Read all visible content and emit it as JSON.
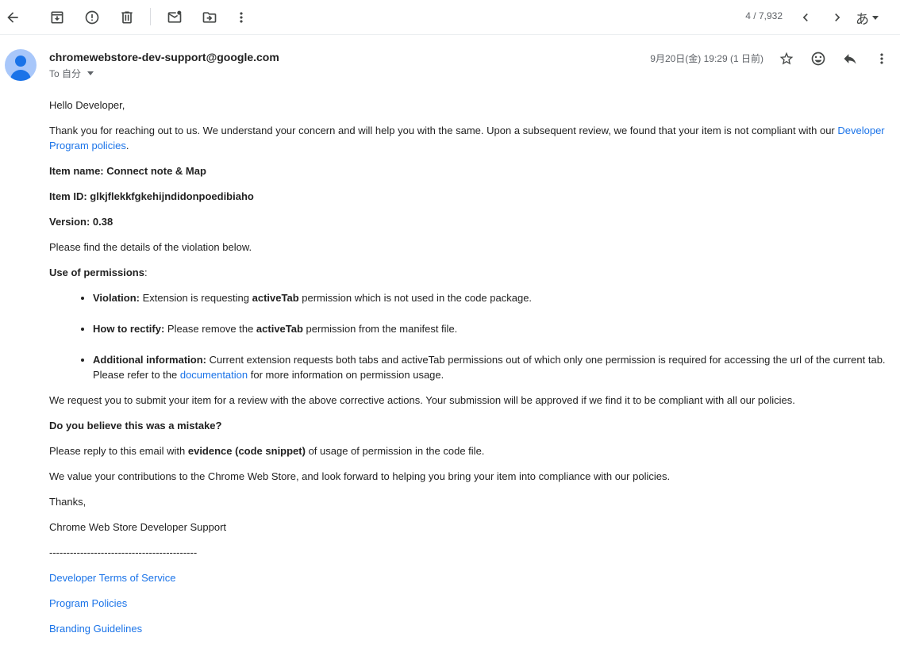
{
  "toolbar": {
    "pager_count": "4 / 7,932",
    "ime_label": "あ"
  },
  "header": {
    "sender": "chromewebstore-dev-support@google.com",
    "recipient": "To 自分",
    "date": "9月20日(金) 19:29 (1 日前)"
  },
  "message": {
    "greeting": "Hello Developer,",
    "intro_text": "Thank you for reaching out to us. We understand your concern and will help you with the same. Upon a subsequent review, we found that your item is not compliant with our ",
    "intro_link": "Developer Program policies",
    "intro_end": ".",
    "item_name_label": "Item name: Connect note & Map",
    "item_id_label": "Item ID: glkjflekkfgkehijndidonpoedibiaho",
    "version_label": "Version: 0.38",
    "details_intro": "Please find the details of the violation below.",
    "use_of_permissions": "Use of permissions",
    "colon": ":",
    "violation": {
      "label": "Violation:",
      "text1": " Extension is requesting ",
      "bold": "activeTab",
      "text2": " permission which is not used in the code package."
    },
    "rectify": {
      "label": "How to rectify:",
      "text1": " Please remove the ",
      "bold": "activeTab",
      "text2": " permission from the manifest file."
    },
    "additional": {
      "label": "Additional information:",
      "text1": " Current extension requests both tabs and activeTab permissions out of which only one permission is required for accessing the url of the current tab. Please refer to the ",
      "link": "documentation",
      "text2": " for more information on permission usage."
    },
    "request_text": "We request you to submit your item for a review with the above corrective actions. Your submission will be approved if we find it to be compliant with all our policies.",
    "mistake_heading": "Do you believe this was a mistake?",
    "reply_text1": "Please reply to this email with ",
    "reply_bold": "evidence (code snippet)",
    "reply_text2": " of usage of permission in the code file.",
    "value_text": "We value your contributions to the Chrome Web Store, and look forward to helping you bring your item into compliance with our policies.",
    "thanks": "Thanks,",
    "signature": "Chrome Web Store Developer Support",
    "separator": "-------------------------------------------",
    "links": [
      "Developer Terms of Service",
      "Program Policies",
      "Branding Guidelines"
    ]
  },
  "icons": {
    "back": "arrow-back-icon",
    "archive": "archive-icon",
    "spam": "report-spam-icon",
    "delete": "trash-icon",
    "unread": "mark-unread-icon",
    "move": "move-to-folder-icon",
    "more": "more-vert-icon",
    "prev": "chevron-left-icon",
    "next": "chevron-right-icon",
    "star": "star-icon",
    "emoji": "emoji-icon",
    "reply": "reply-icon"
  },
  "colors": {
    "link": "#1a73e8",
    "avatar_bg": "#a8c7fa",
    "avatar_fg": "#1a73e8"
  }
}
